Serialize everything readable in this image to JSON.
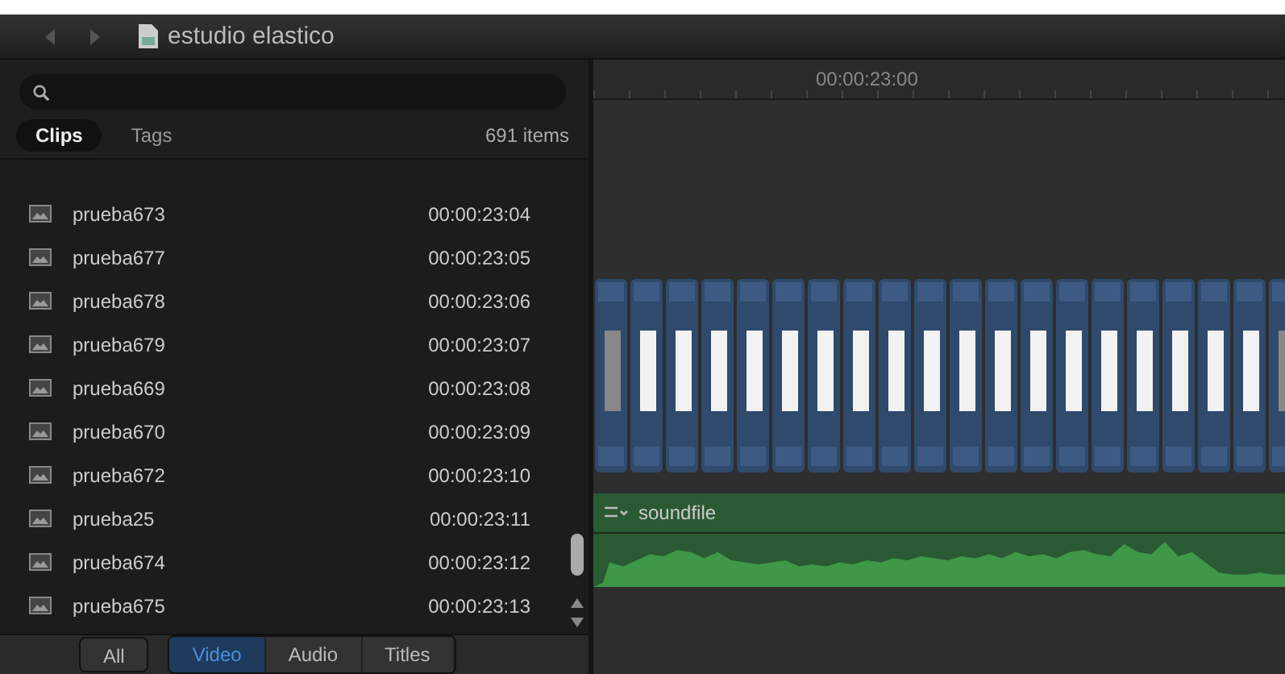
{
  "window": {
    "title": "estudio elastico"
  },
  "tabs": [
    {
      "label": "Clips",
      "selected": true
    },
    {
      "label": "Tags",
      "selected": false
    }
  ],
  "item_count": "691 items",
  "clips": [
    {
      "name": "prueba673",
      "time": "00:00:23:04"
    },
    {
      "name": "prueba677",
      "time": "00:00:23:05"
    },
    {
      "name": "prueba678",
      "time": "00:00:23:06"
    },
    {
      "name": "prueba679",
      "time": "00:00:23:07"
    },
    {
      "name": "prueba669",
      "time": "00:00:23:08"
    },
    {
      "name": "prueba670",
      "time": "00:00:23:09"
    },
    {
      "name": "prueba672",
      "time": "00:00:23:10"
    },
    {
      "name": "prueba25",
      "time": "00:00:23:11"
    },
    {
      "name": "prueba674",
      "time": "00:00:23:12"
    },
    {
      "name": "prueba675",
      "time": "00:00:23:13"
    }
  ],
  "filters": [
    {
      "label": "All",
      "selected": false
    },
    {
      "label": "Video",
      "selected": true
    },
    {
      "label": "Audio",
      "selected": false
    },
    {
      "label": "Titles",
      "selected": false
    }
  ],
  "timeline": {
    "ruler_label": "00:00:23:00",
    "audio_clip": "soundfile"
  }
}
